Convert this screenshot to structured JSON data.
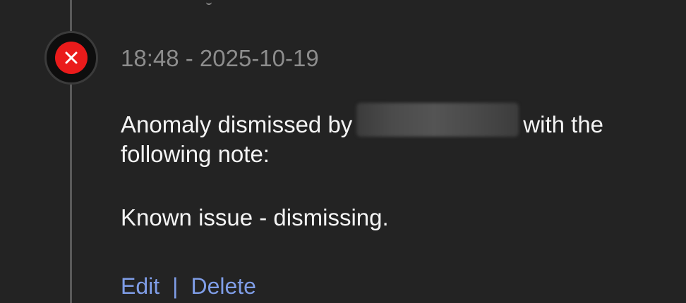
{
  "event": {
    "timestamp": "18:48 - 2025-10-19",
    "status_icon": "close-icon",
    "status_color": "#ea1b1b",
    "message_prefix": "Anomaly dismissed by",
    "message_suffix": "with the",
    "message_line2": "following note:",
    "note": "Known issue - dismissing."
  },
  "actions": {
    "edit_label": "Edit",
    "separator": "|",
    "delete_label": "Delete"
  },
  "colors": {
    "background": "#232323",
    "link": "#7f9de7",
    "timestamp": "#8d8d8d",
    "text": "#f4f4f4"
  }
}
